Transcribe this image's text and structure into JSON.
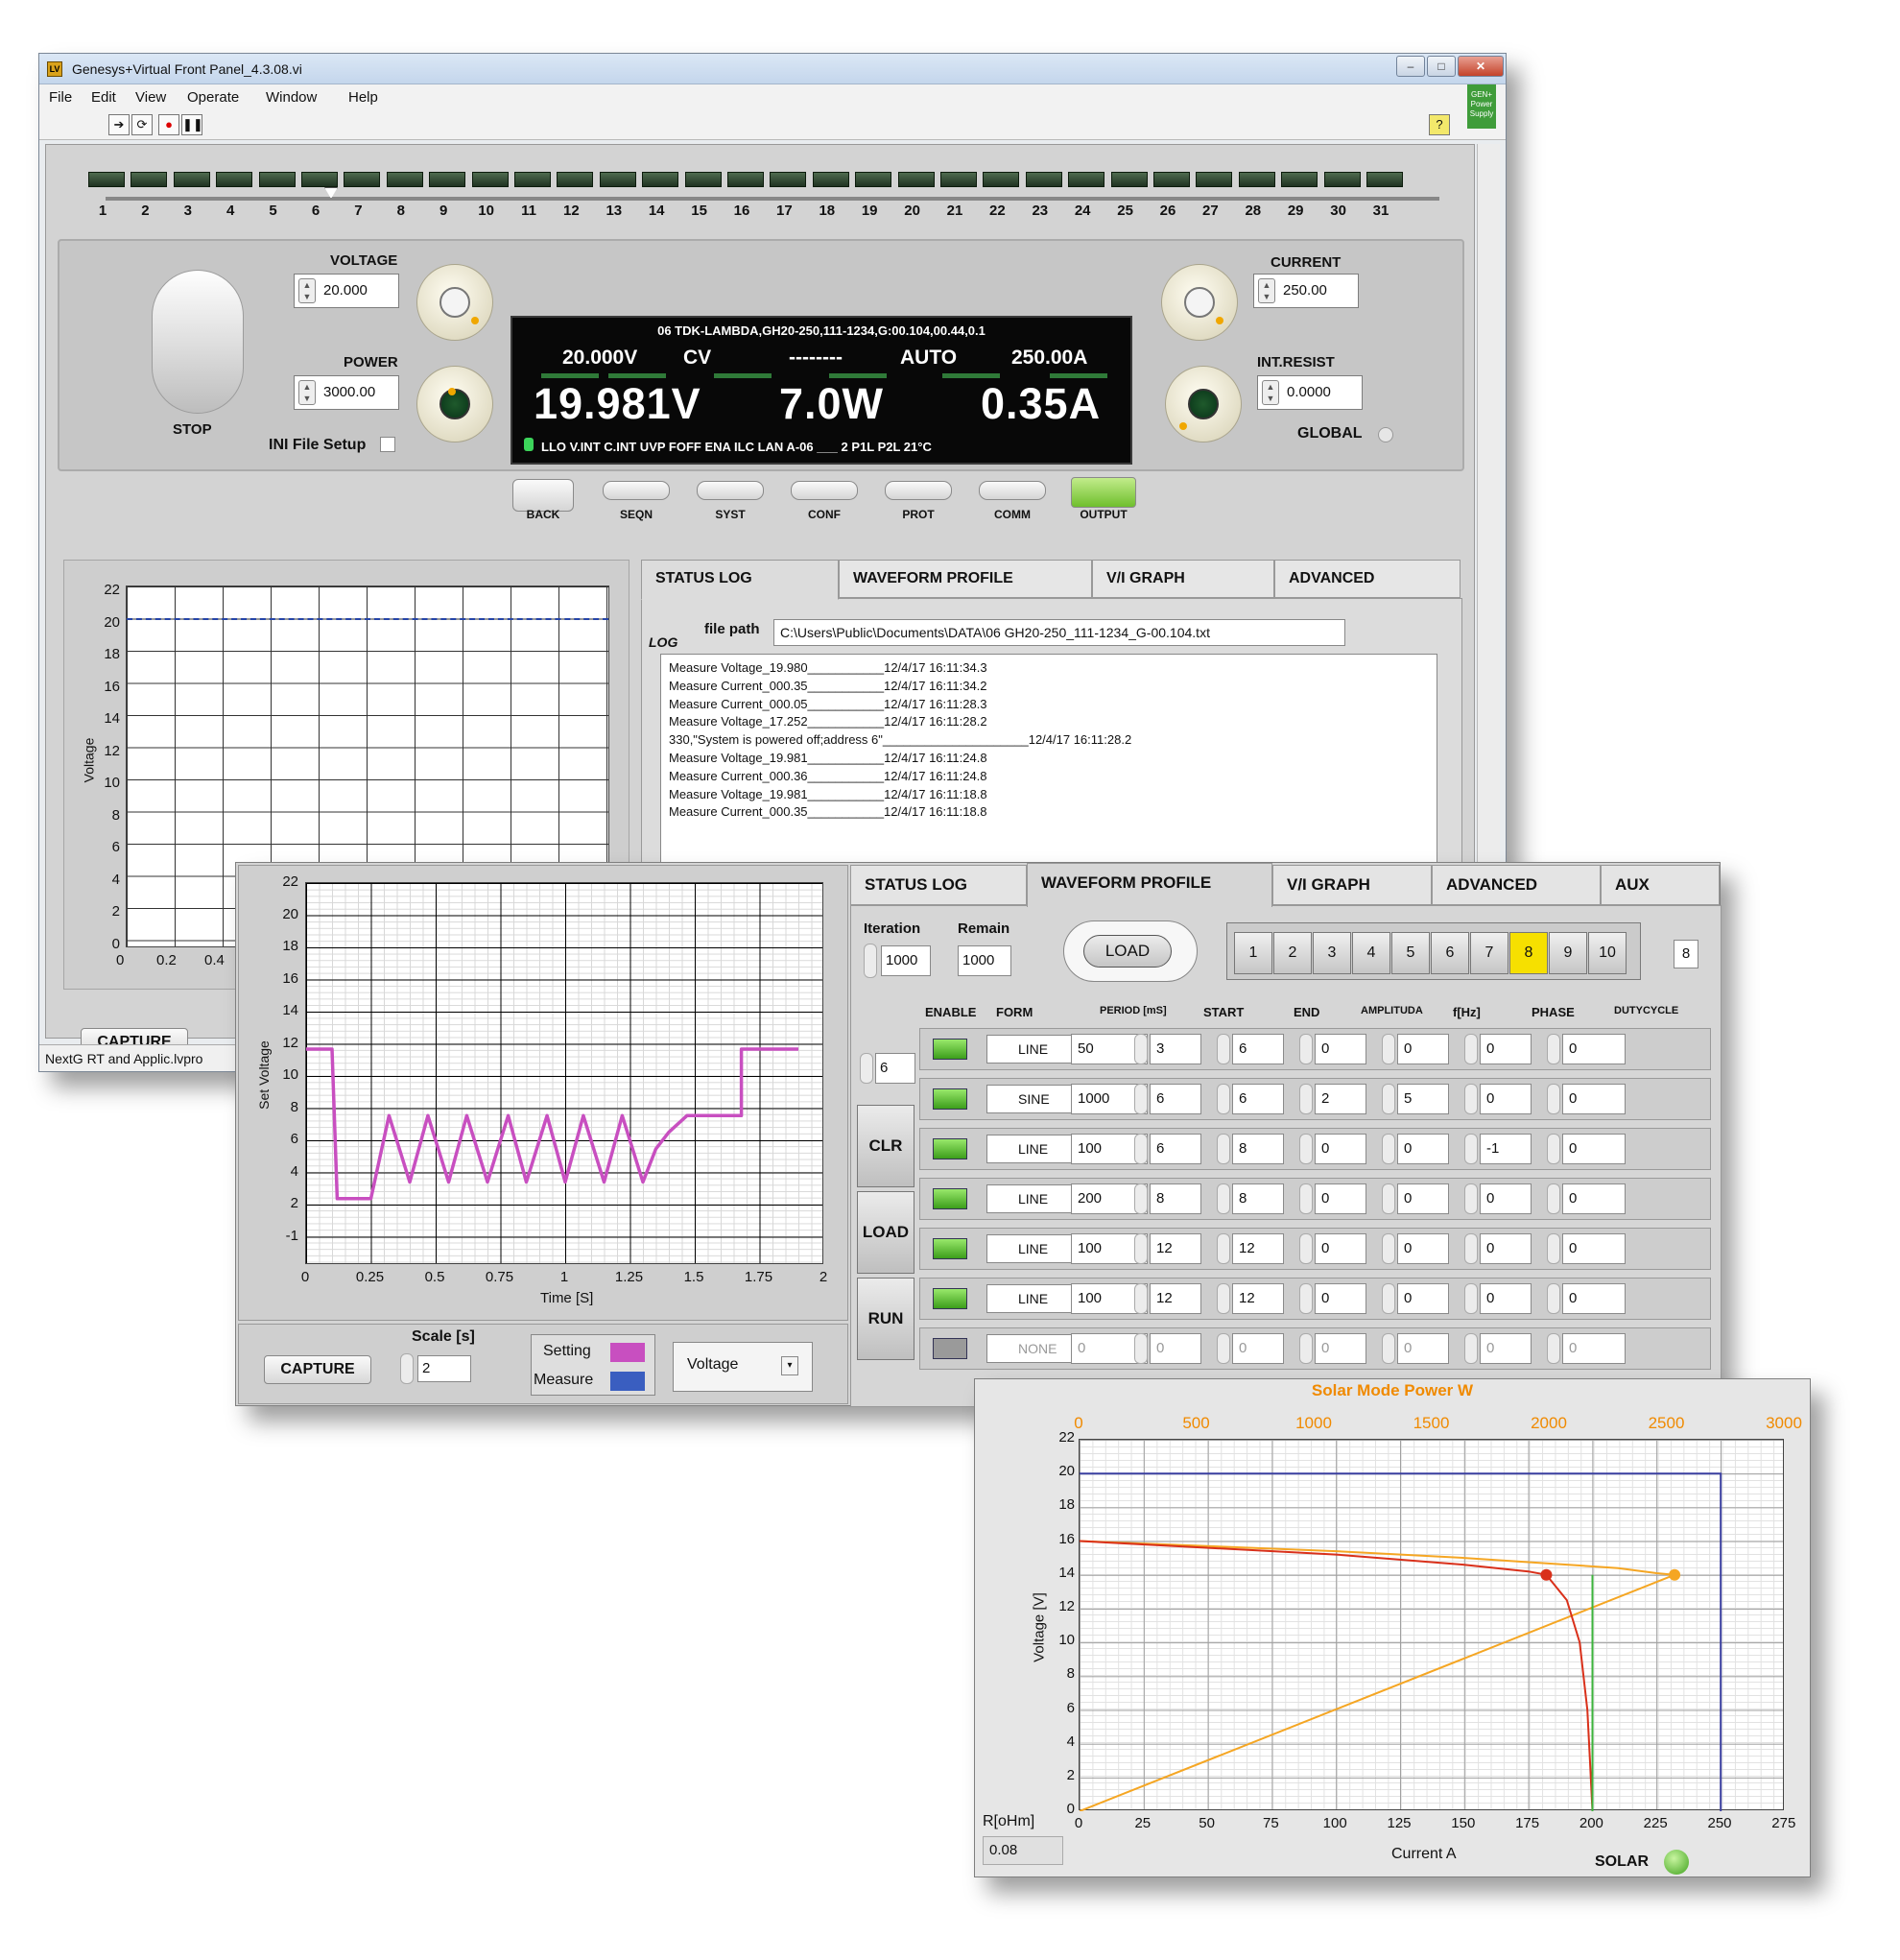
{
  "main_window": {
    "title": "Genesys+Virtual Front Panel_4.3.08.vi",
    "menu": [
      "File",
      "Edit",
      "View",
      "Operate",
      "Window",
      "Help"
    ],
    "brand_badge": "GEN+ Power Supply",
    "help_icon": "?",
    "address_ticks": [
      "1",
      "2",
      "3",
      "4",
      "5",
      "6",
      "7",
      "8",
      "9",
      "10",
      "11",
      "12",
      "13",
      "14",
      "15",
      "16",
      "17",
      "18",
      "19",
      "20",
      "21",
      "22",
      "23",
      "24",
      "25",
      "26",
      "27",
      "28",
      "29",
      "30",
      "31"
    ],
    "selected_address": "6",
    "stop_label": "STOP",
    "voltage_label": "VOLTAGE",
    "voltage_value": "20.000",
    "power_label": "POWER",
    "power_value": "3000.00",
    "ini_label": "INI File Setup",
    "current_label": "CURRENT",
    "current_value": "250.00",
    "intresist_label": "INT.RESIST",
    "intresist_value": "0.0000",
    "global_label": "GLOBAL",
    "display": {
      "header": "06  TDK-LAMBDA,GH20-250,111-1234,G:00.104,00.44,0.1",
      "set_v": "20.000V",
      "mode": "CV",
      "dashes": "--------",
      "auto": "AUTO",
      "set_a": "250.00A",
      "meas_v": "19.981V",
      "meas_w": "7.0W",
      "meas_a": "0.35A",
      "status": "LLO  V.INT  C.INT  UVP  FOFF   ENA  ILC   LAN   A-06   ___   2   P1L  P2L  21°C"
    },
    "function_buttons": [
      "BACK",
      "SEQN",
      "SYST",
      "CONF",
      "PROT",
      "COMM",
      "OUTPUT"
    ],
    "graph": {
      "y_axis_label": "Voltage",
      "y_ticks": [
        "22",
        "20",
        "18",
        "16",
        "14",
        "12",
        "10",
        "8",
        "6",
        "4",
        "2",
        "0"
      ],
      "x_ticks": [
        "0",
        "0.2",
        "0.4"
      ]
    },
    "tabs": [
      "STATUS LOG",
      "WAVEFORM PROFILE",
      "V/I GRAPH",
      "ADVANCED"
    ],
    "log_label": "LOG",
    "file_path_label": "file path",
    "file_path": "C:\\Users\\Public\\Documents\\DATA\\06 GH20-250_111-1234_G-00.104.txt",
    "log_lines": [
      "Measure Voltage_19.980___________12/4/17 16:11:34.3",
      "Measure Current_000.35___________12/4/17 16:11:34.2",
      "Measure Current_000.05___________12/4/17 16:11:28.3",
      "Measure Voltage_17.252___________12/4/17 16:11:28.2",
      "330,\"System is powered off;address 6\"_____________________12/4/17 16:11:28.2",
      "Measure Voltage_19.981___________12/4/17 16:11:24.8",
      "Measure Current_000.36___________12/4/17 16:11:24.8",
      "Measure Voltage_19.981___________12/4/17 16:11:18.8",
      "Measure Current_000.35___________12/4/17 16:11:18.8"
    ],
    "capture_label": "CAPTURE",
    "status_bar": "NextG RT and Applic.lvpro"
  },
  "waveform_window": {
    "tabs": [
      "STATUS LOG",
      "WAVEFORM PROFILE",
      "V/I GRAPH",
      "ADVANCED",
      "AUX"
    ],
    "iteration_label": "Iteration",
    "iteration_value": "1000",
    "remain_label": "Remain",
    "remain_value": "1000",
    "load_top": "LOAD",
    "seq_buttons": [
      "1",
      "2",
      "3",
      "4",
      "5",
      "6",
      "7",
      "8",
      "9",
      "10"
    ],
    "active_seq": "8",
    "seq_indicator": "8",
    "col_headers": [
      "ENABLE",
      "FORM",
      "PERIOD [mS]",
      "START",
      "END",
      "AMPLITUDA",
      "f[Hz]",
      "PHASE",
      "DUTYCYCLE"
    ],
    "step_count": "6",
    "side_buttons": [
      "CLR",
      "LOAD",
      "RUN"
    ],
    "rows": [
      {
        "enable": true,
        "form": "LINE",
        "period": "50",
        "start": "3",
        "end": "6",
        "amp": "0",
        "f": "0",
        "phase": "0",
        "duty": "0"
      },
      {
        "enable": true,
        "form": "SINE",
        "period": "1000",
        "start": "6",
        "end": "6",
        "amp": "2",
        "f": "5",
        "phase": "0",
        "duty": "0"
      },
      {
        "enable": true,
        "form": "LINE",
        "period": "100",
        "start": "6",
        "end": "8",
        "amp": "0",
        "f": "0",
        "phase": "-1",
        "duty": "0"
      },
      {
        "enable": true,
        "form": "LINE",
        "period": "200",
        "start": "8",
        "end": "8",
        "amp": "0",
        "f": "0",
        "phase": "0",
        "duty": "0"
      },
      {
        "enable": true,
        "form": "LINE",
        "period": "100",
        "start": "12",
        "end": "12",
        "amp": "0",
        "f": "0",
        "phase": "0",
        "duty": "0"
      },
      {
        "enable": true,
        "form": "LINE",
        "period": "100",
        "start": "12",
        "end": "12",
        "amp": "0",
        "f": "0",
        "phase": "0",
        "duty": "0"
      },
      {
        "enable": false,
        "form": "NONE",
        "period": "0",
        "start": "0",
        "end": "0",
        "amp": "0",
        "f": "0",
        "phase": "0",
        "duty": "0"
      }
    ],
    "capture_label": "CAPTURE",
    "scale_label": "Scale [s]",
    "scale_value": "2",
    "setting_label": "Setting",
    "measure_label": "Measure",
    "plot_select": "Voltage",
    "colors": {
      "setting": "#c84fc0",
      "measure": "#3a5ec0"
    }
  },
  "solar_window": {
    "r_label": "R[oHm]",
    "r_value": "0.08",
    "solar_label": "SOLAR",
    "colors": {
      "blue": "#3a3fa0",
      "orange": "#f5a623",
      "red": "#d9301a",
      "green": "#3cb43c"
    }
  },
  "chart_data": [
    {
      "type": "line",
      "ylabel": "Set Voltage",
      "xlabel": "Time [S]",
      "xlim": [
        0,
        2
      ],
      "ylim": [
        -1,
        22
      ],
      "x_ticks": [
        "0",
        "0.25",
        "0.5",
        "0.75",
        "1",
        "1.25",
        "1.5",
        "1.75",
        "2"
      ],
      "y_ticks": [
        "22",
        "20",
        "18",
        "16",
        "14",
        "12",
        "10",
        "8",
        "6",
        "4",
        "2",
        "-1"
      ],
      "series": [
        {
          "name": "Setting",
          "x": [
            0,
            0.1,
            0.12,
            0.2,
            0.25,
            0.32,
            0.4,
            0.47,
            0.55,
            0.62,
            0.7,
            0.78,
            0.85,
            0.93,
            1.0,
            1.07,
            1.15,
            1.22,
            1.3,
            1.35,
            1.4,
            1.47,
            1.68,
            1.68,
            1.9
          ],
          "y": [
            12,
            12,
            3,
            3,
            3,
            8,
            4,
            8,
            4,
            8,
            4,
            8,
            4,
            8,
            4,
            8,
            4,
            8,
            4,
            6,
            7,
            8,
            8,
            12,
            12
          ]
        }
      ]
    },
    {
      "type": "line",
      "title": "Solar Mode Power W",
      "xlabel": "Current A",
      "ylabel": "Voltage [V]",
      "xlim": [
        0,
        275
      ],
      "ylim": [
        0,
        22
      ],
      "top_xlim": [
        0,
        3000
      ],
      "x_ticks": [
        "0",
        "25",
        "50",
        "75",
        "100",
        "125",
        "150",
        "175",
        "200",
        "225",
        "250",
        "275"
      ],
      "top_ticks": [
        "0",
        "500",
        "1000",
        "1500",
        "2000",
        "2500",
        "3000"
      ],
      "y_ticks": [
        "22",
        "20",
        "18",
        "16",
        "14",
        "12",
        "10",
        "8",
        "6",
        "4",
        "2",
        "0"
      ],
      "series": [
        {
          "name": "limit",
          "x": [
            0,
            250,
            250
          ],
          "y": [
            20,
            20,
            0
          ]
        },
        {
          "name": "power curve",
          "x": [
            0,
            100,
            150,
            180,
            210,
            225,
            232
          ],
          "y": [
            16,
            15.4,
            15,
            14.7,
            14.4,
            14.1,
            14
          ]
        },
        {
          "name": "load line",
          "x": [
            0,
            232
          ],
          "y": [
            0,
            14
          ]
        },
        {
          "name": "IV curve",
          "x": [
            0,
            100,
            150,
            175,
            182,
            190,
            195,
            198,
            199,
            200
          ],
          "y": [
            16,
            15.2,
            14.6,
            14.2,
            14,
            12.5,
            10,
            6,
            3,
            0
          ]
        },
        {
          "name": "current marker",
          "x": [
            200,
            200
          ],
          "y": [
            0,
            14
          ]
        }
      ],
      "markers": [
        {
          "x": 182,
          "y": 14
        },
        {
          "x": 232,
          "y": 14
        }
      ]
    }
  ]
}
